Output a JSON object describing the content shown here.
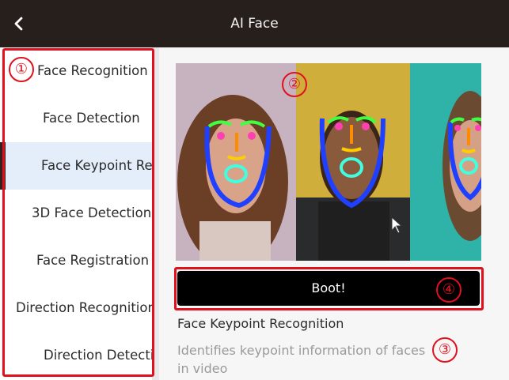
{
  "header": {
    "back_icon": "chevron-left-icon",
    "title": "AI Face"
  },
  "sidebar": {
    "items": [
      {
        "label": "Face Recognition"
      },
      {
        "label": "Face Detection"
      },
      {
        "label": "Face Keypoint Recognition"
      },
      {
        "label": "3D Face Detection"
      },
      {
        "label": "Face Registration"
      },
      {
        "label": "Direction Recognition"
      },
      {
        "label": "Direction Detection"
      }
    ]
  },
  "main": {
    "boot_label": "Boot!",
    "feature_title": "Face Keypoint Recognition",
    "feature_description": "Identifies keypoint information of faces in video"
  },
  "annotations": {
    "n1": "①",
    "n2": "②",
    "n3": "③",
    "n4": "④"
  },
  "colors": {
    "annotation": "#e0101d",
    "topbar": "#261f1b",
    "active_item": "#e4eefb"
  }
}
